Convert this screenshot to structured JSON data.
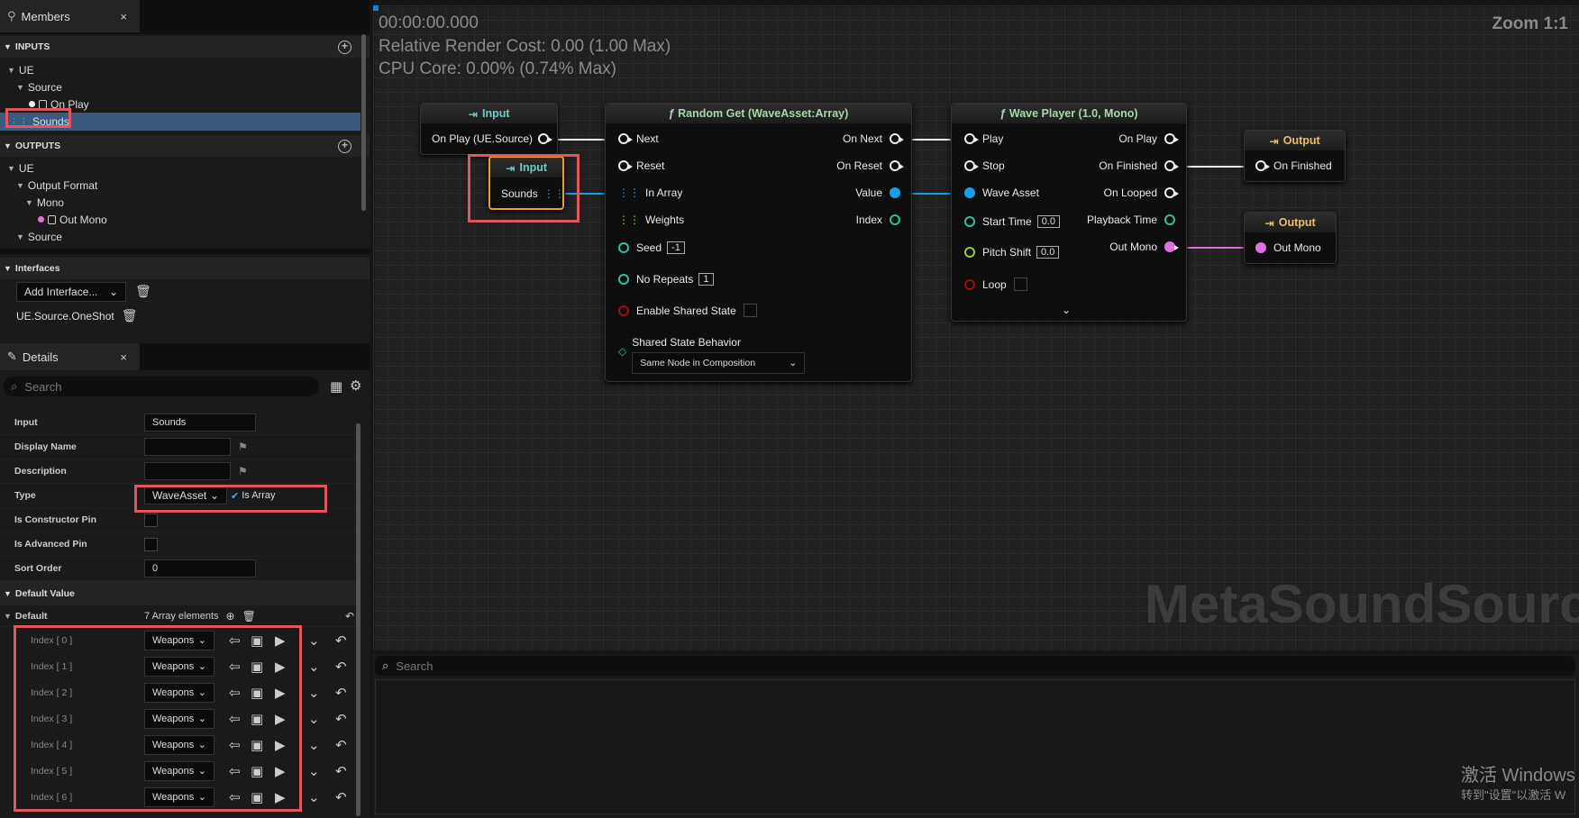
{
  "members": {
    "tab_label": "Members",
    "close": "×",
    "inputs_header": "INPUTS",
    "outputs_header": "OUTPUTS",
    "add": "+",
    "inputs": {
      "ue": "UE",
      "source": "Source",
      "on_play": "On Play",
      "sounds": "Sounds"
    },
    "outputs": {
      "ue": "UE",
      "output_format": "Output Format",
      "mono": "Mono",
      "out_mono": "Out Mono",
      "source": "Source"
    },
    "interfaces_header": "Interfaces",
    "add_interface": "Add Interface...",
    "interface_item": "UE.Source.OneShot"
  },
  "details": {
    "tab_label": "Details",
    "close": "×",
    "search_placeholder": "Search",
    "input_label": "Input",
    "input_value": "Sounds",
    "display_name_label": "Display Name",
    "description_label": "Description",
    "type_label": "Type",
    "type_value": "WaveAsset",
    "is_array_label": "Is Array",
    "is_array_checked": true,
    "constructor_label": "Is Constructor Pin",
    "advanced_label": "Is Advanced Pin",
    "sort_order_label": "Sort Order",
    "sort_order_value": "0",
    "default_value_header": "Default Value",
    "default_label": "Default",
    "array_count": "7 Array elements",
    "array": [
      {
        "index": "Index [ 0 ]",
        "value": "Weapons"
      },
      {
        "index": "Index [ 1 ]",
        "value": "Weapons"
      },
      {
        "index": "Index [ 2 ]",
        "value": "Weapons"
      },
      {
        "index": "Index [ 3 ]",
        "value": "Weapons"
      },
      {
        "index": "Index [ 4 ]",
        "value": "Weapons"
      },
      {
        "index": "Index [ 5 ]",
        "value": "Weapons"
      },
      {
        "index": "Index [ 6 ]",
        "value": "Weapons"
      }
    ]
  },
  "graph": {
    "time": "00:00:00.000",
    "render_cost": "Relative Render Cost: 0.00 (1.00 Max)",
    "cpu_core": "CPU Core: 0.00% (0.74% Max)",
    "zoom": "Zoom 1:1",
    "watermark": "MetaSoundSource",
    "input_node1": {
      "title": "Input",
      "pin": "On Play (UE.Source)"
    },
    "input_node2": {
      "title": "Input",
      "pin": "Sounds"
    },
    "random_get": {
      "title": "ƒ Random Get (WaveAsset:Array)",
      "inputs": [
        "Next",
        "Reset",
        "In Array",
        "Weights",
        "Seed",
        "No Repeats",
        "Enable Shared State",
        "Shared State Behavior"
      ],
      "outputs": [
        "On Next",
        "On Reset",
        "Value",
        "Index"
      ],
      "seed_value": "-1",
      "no_repeats_value": "1",
      "shared_state_value": "Same Node in Composition"
    },
    "wave_player": {
      "title": "ƒ Wave Player (1.0, Mono)",
      "inputs": [
        "Play",
        "Stop",
        "Wave Asset",
        "Start Time",
        "Pitch Shift",
        "Loop"
      ],
      "outputs": [
        "On Play",
        "On Finished",
        "On Looped",
        "Playback Time",
        "Out Mono"
      ],
      "start_time_value": "0.0",
      "pitch_shift_value": "0.0"
    },
    "output_node1": {
      "title": "Output",
      "pin": "On Finished"
    },
    "output_node2": {
      "title": "Output",
      "pin": "Out Mono"
    }
  },
  "bottom": {
    "search_placeholder": "Search"
  },
  "windows_watermark": {
    "line1": "激活 Windows",
    "line2": "转到\"设置\"以激活 W"
  },
  "colors": {
    "accent_red": "#e05560",
    "selection": "#3b5a80",
    "pin_blue": "#1aa0e8",
    "pin_pink": "#e070e0",
    "pin_teal": "#30c0a0"
  }
}
